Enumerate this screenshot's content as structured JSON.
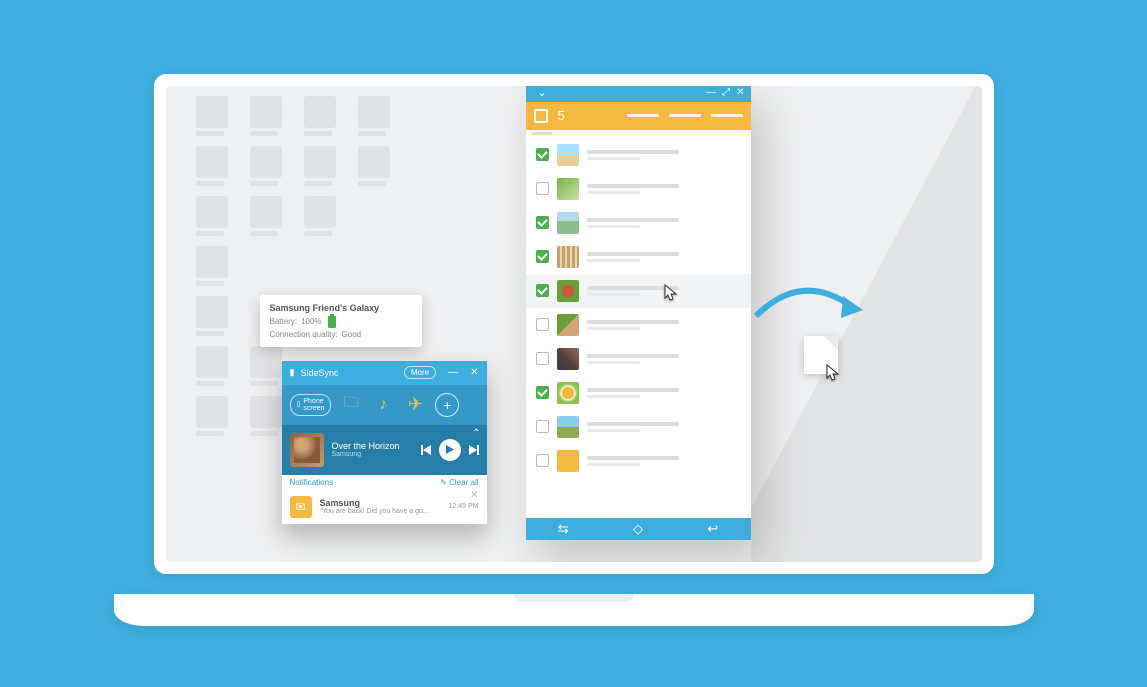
{
  "tooltip": {
    "title": "Samsung Friend's Galaxy",
    "battery_label": "Battery:",
    "battery_value": "100%",
    "conn_label": "Connection quality:",
    "conn_value": "Good"
  },
  "dashboard": {
    "app_name": "SideSync",
    "more": "More",
    "phone_screen": "Phone\nscreen",
    "track_title": "Over the Horizon",
    "track_artist": "Samsung",
    "notifications_label": "Notifications",
    "clear_all": "Clear all",
    "notif_sender": "Samsung",
    "notif_preview": "\"You are back! Did you have a go...",
    "notif_time": "12:45 PM"
  },
  "filewin": {
    "selected_count": "5",
    "rows": [
      {
        "checked": true,
        "thumb": "t1"
      },
      {
        "checked": false,
        "thumb": "t2"
      },
      {
        "checked": true,
        "thumb": "t3"
      },
      {
        "checked": true,
        "thumb": "t4"
      },
      {
        "checked": true,
        "thumb": "t5",
        "highlight": true
      },
      {
        "checked": false,
        "thumb": "t6"
      },
      {
        "checked": false,
        "thumb": "t7"
      },
      {
        "checked": true,
        "thumb": "t8"
      },
      {
        "checked": false,
        "thumb": "t9"
      },
      {
        "checked": false,
        "thumb": "t10"
      }
    ]
  },
  "colors": {
    "accent": "#3eaede",
    "amber": "#f5b942",
    "green": "#4caf50"
  }
}
